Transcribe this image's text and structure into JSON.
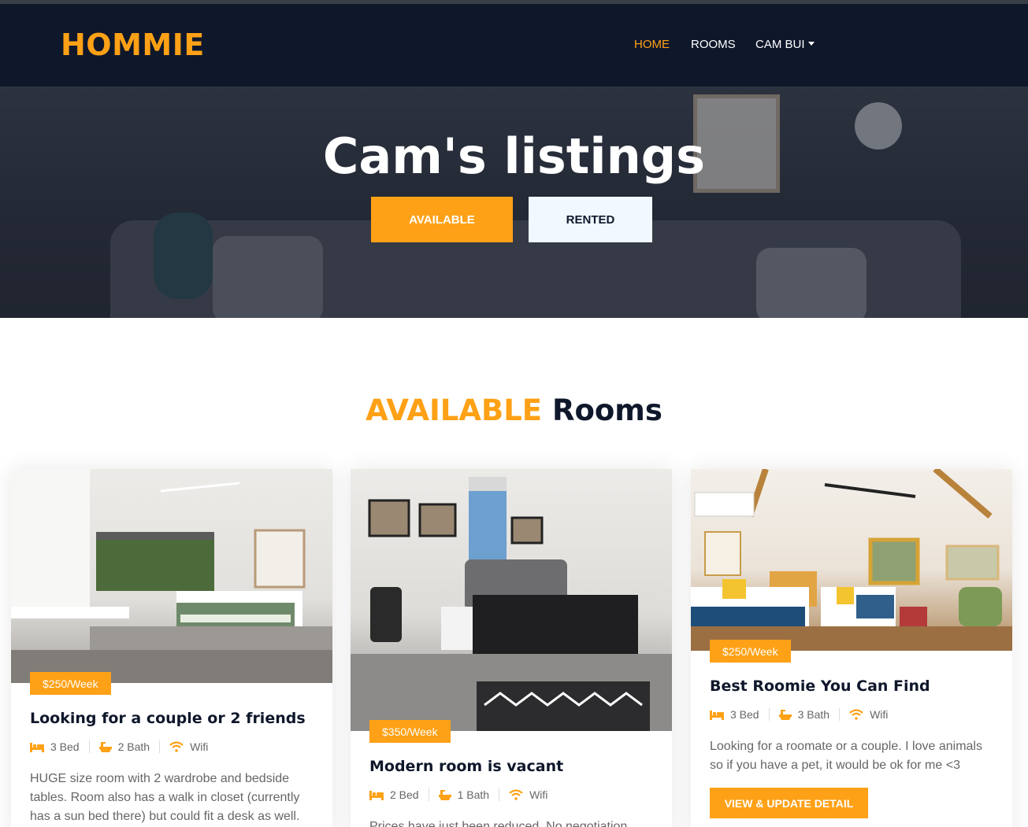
{
  "brand": "HOMMIE",
  "nav": {
    "home": "HOME",
    "rooms": "ROOMS",
    "user": "CAM BUI"
  },
  "hero": {
    "title": "Cam's listings",
    "available_label": "AVAILABLE",
    "rented_label": "RENTED"
  },
  "section": {
    "title_accent": "AVAILABLE",
    "title_rest": "Rooms"
  },
  "colors": {
    "accent": "#fea116",
    "dark": "#0f172b"
  },
  "icons": {
    "bed": "bed-icon",
    "bath": "bath-icon",
    "wifi": "wifi-icon"
  },
  "rooms": [
    {
      "price": "$250/Week",
      "title": "Looking for a couple or 2 friends",
      "bed": "3 Bed",
      "bath": "2 Bath",
      "wifi": "Wifi",
      "description": "HUGE size room with 2 wardrobe and bedside tables. Room also has a walk in closet (currently has a sun bed there) but could fit a desk as well."
    },
    {
      "price": "$350/Week",
      "title": "Modern room is vacant",
      "bed": "2 Bed",
      "bath": "1 Bath",
      "wifi": "Wifi",
      "description": "Prices have just been reduced. No negotiation"
    },
    {
      "price": "$250/Week",
      "title": "Best Roomie You Can Find",
      "bed": "3 Bed",
      "bath": "3 Bath",
      "wifi": "Wifi",
      "description": "Looking for a roomate or a couple. I love animals so if you have a pet, it would be ok for me <3",
      "button": "VIEW & UPDATE DETAIL"
    }
  ]
}
